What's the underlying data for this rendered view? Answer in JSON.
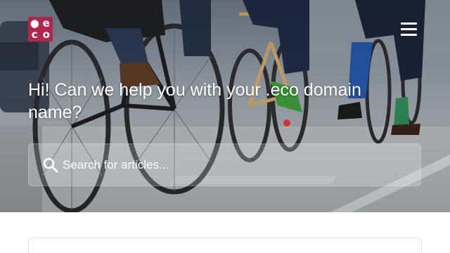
{
  "logo": {
    "letters": [
      "●",
      "e",
      "c",
      "o"
    ],
    "brand_color": "#b3244f"
  },
  "header": {
    "menu_icon": "hamburger-menu-icon"
  },
  "hero": {
    "title": "Hi! Can we help you with your .eco domain name?",
    "image": "cyclists-on-bike-lane-photo"
  },
  "search": {
    "placeholder": "Search for articles...",
    "value": "",
    "icon": "search-icon"
  }
}
